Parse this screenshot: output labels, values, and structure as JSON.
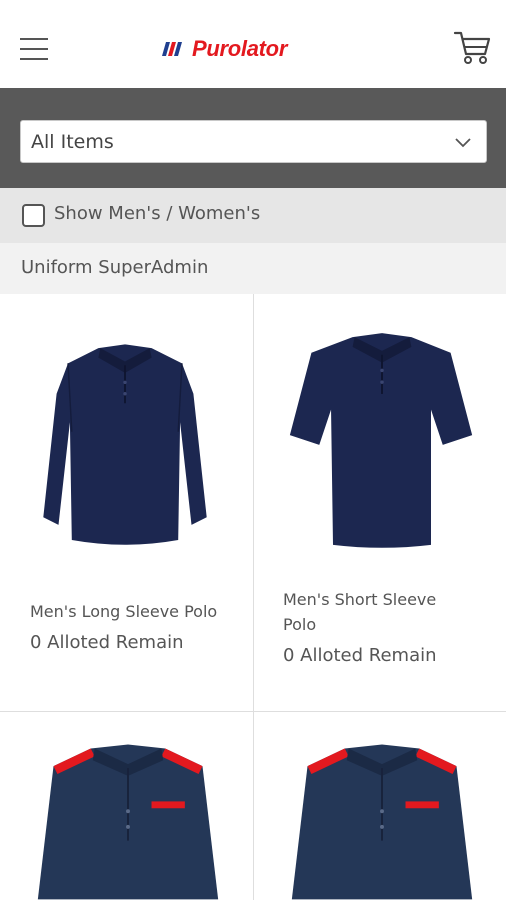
{
  "header": {
    "brand": "Purolator",
    "menu_icon": "hamburger-menu-icon",
    "cart_icon": "shopping-cart-icon"
  },
  "filter": {
    "selected": "All Items"
  },
  "toggle": {
    "label": "Show Men's / Women's",
    "checked": false
  },
  "role": {
    "label": "Uniform SuperAdmin"
  },
  "products": [
    {
      "name": "Men's Long Sleeve Polo",
      "remain": "0 Alloted Remain"
    },
    {
      "name": "Men's Short Sleeve Polo",
      "remain": "0 Alloted Remain"
    },
    {
      "name": "",
      "remain": ""
    },
    {
      "name": "",
      "remain": ""
    }
  ],
  "colors": {
    "brand_red": "#e3191f",
    "brand_blue": "#1f3f8f",
    "filter_bar": "#595959",
    "navy_polo": "#1c2750"
  }
}
